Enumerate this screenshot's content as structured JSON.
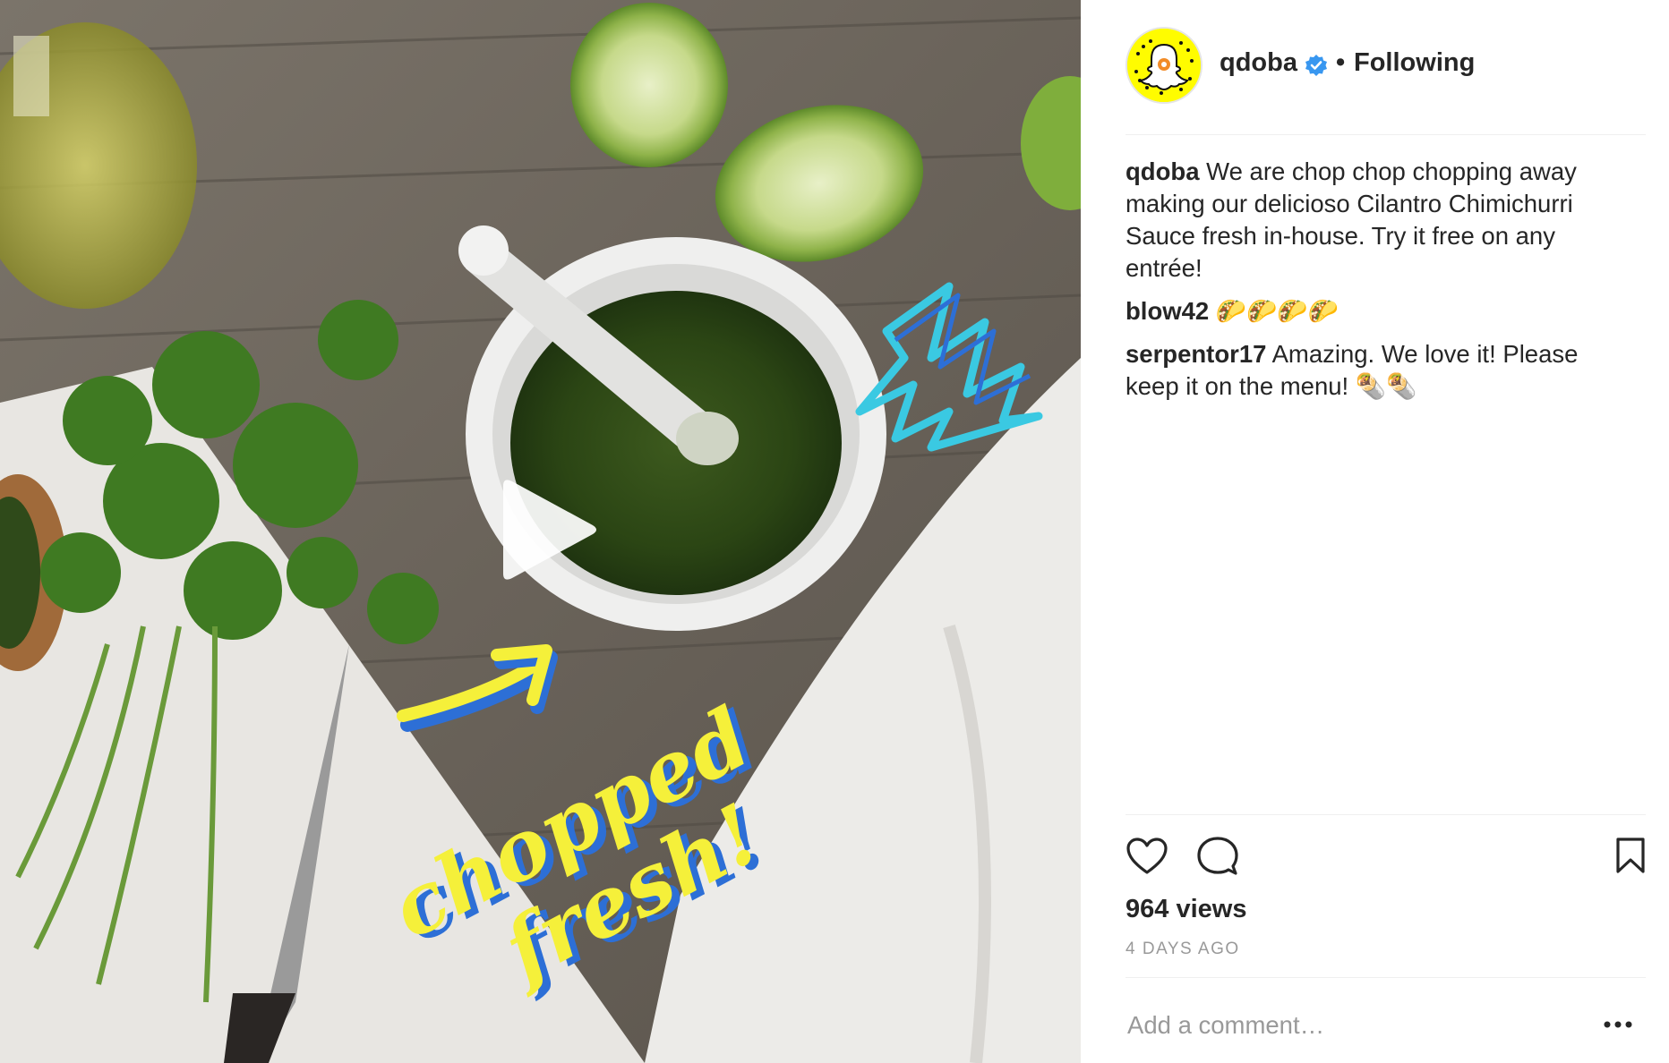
{
  "post": {
    "overlay_text_line1": "chopped",
    "overlay_text_line2": "fresh!"
  },
  "header": {
    "username": "qdoba",
    "separator": "•",
    "follow_status": "Following"
  },
  "comments": [
    {
      "user": "qdoba",
      "text": "We are chop chop chopping away making our delicioso Cilantro Chimichurri Sauce fresh in-house. Try it free on any entrée!"
    },
    {
      "user": "blow42",
      "text": "🌮🌮🌮🌮"
    },
    {
      "user": "serpentor17",
      "text": "Amazing. We love it! Please keep it on the menu! 🌯🌯"
    }
  ],
  "stats": {
    "views": "964 views",
    "time_ago": "4 DAYS AGO"
  },
  "comment_box": {
    "placeholder": "Add a comment…"
  },
  "colors": {
    "verified": "#3897f0",
    "snap_yellow": "#fffc00",
    "sticker_yellow": "#f5f03a",
    "sticker_blue": "#2d6fd6"
  }
}
